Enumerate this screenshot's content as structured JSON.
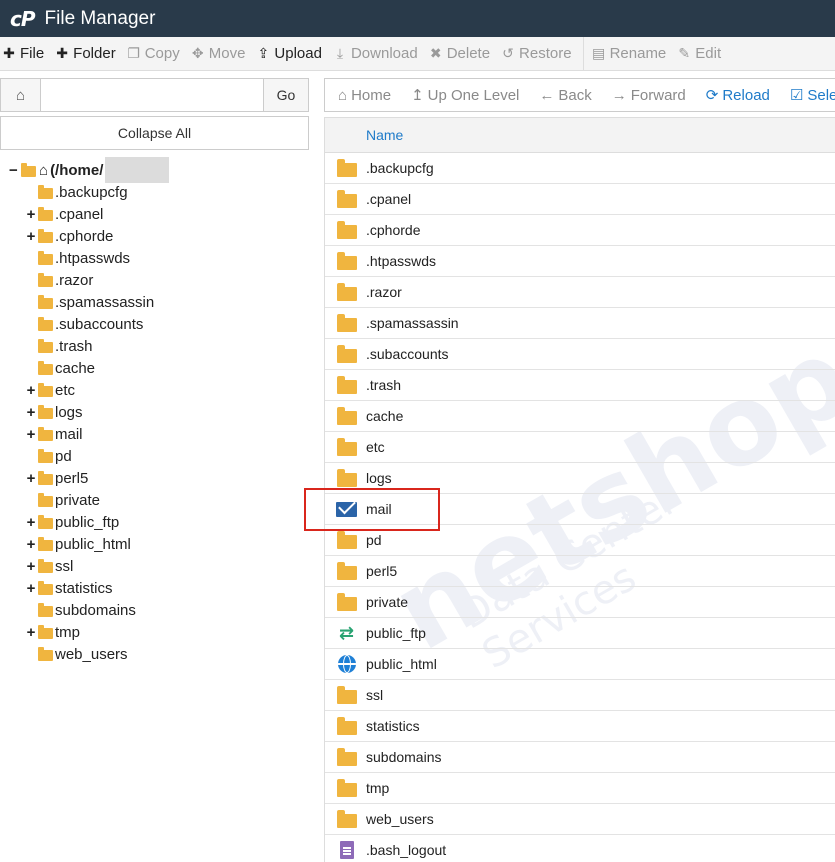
{
  "app": {
    "logo": "cP",
    "title": "File Manager"
  },
  "toolbar": [
    {
      "icon": "plus-icon",
      "glyph": "✚",
      "label": "File",
      "enabled": true
    },
    {
      "icon": "plus-icon",
      "glyph": "✚",
      "label": "Folder",
      "enabled": true
    },
    {
      "icon": "copy-icon",
      "glyph": "❐",
      "label": "Copy",
      "enabled": false
    },
    {
      "icon": "move-icon",
      "glyph": "✥",
      "label": "Move",
      "enabled": false
    },
    {
      "icon": "upload-icon",
      "glyph": "⇪",
      "label": "Upload",
      "enabled": true
    },
    {
      "icon": "download-icon",
      "glyph": "⤓",
      "label": "Download",
      "enabled": false
    },
    {
      "icon": "delete-icon",
      "glyph": "✖",
      "label": "Delete",
      "enabled": false
    },
    {
      "icon": "restore-icon",
      "glyph": "↺",
      "label": "Restore",
      "enabled": false
    },
    {
      "icon": "rename-icon",
      "glyph": "▤",
      "label": "Rename",
      "enabled": false
    },
    {
      "icon": "edit-icon",
      "glyph": "✎",
      "label": "Edit",
      "enabled": false
    }
  ],
  "search": {
    "value": "",
    "go_label": "Go"
  },
  "collapse_label": "Collapse All",
  "tree": {
    "root_label": "(/home/",
    "items": [
      {
        "label": ".backupcfg",
        "expandable": false
      },
      {
        "label": ".cpanel",
        "expandable": true
      },
      {
        "label": ".cphorde",
        "expandable": true
      },
      {
        "label": ".htpasswds",
        "expandable": false
      },
      {
        "label": ".razor",
        "expandable": false
      },
      {
        "label": ".spamassassin",
        "expandable": false
      },
      {
        "label": ".subaccounts",
        "expandable": false
      },
      {
        "label": ".trash",
        "expandable": false
      },
      {
        "label": "cache",
        "expandable": false
      },
      {
        "label": "etc",
        "expandable": true
      },
      {
        "label": "logs",
        "expandable": true
      },
      {
        "label": "mail",
        "expandable": true
      },
      {
        "label": "pd",
        "expandable": false
      },
      {
        "label": "perl5",
        "expandable": true
      },
      {
        "label": "private",
        "expandable": false
      },
      {
        "label": "public_ftp",
        "expandable": true
      },
      {
        "label": "public_html",
        "expandable": true
      },
      {
        "label": "ssl",
        "expandable": true
      },
      {
        "label": "statistics",
        "expandable": true
      },
      {
        "label": "subdomains",
        "expandable": false
      },
      {
        "label": "tmp",
        "expandable": true
      },
      {
        "label": "web_users",
        "expandable": false
      }
    ]
  },
  "nav": [
    {
      "icon": "home-icon",
      "glyph": "⌂",
      "label": "Home",
      "style": "grey"
    },
    {
      "icon": "level-up-icon",
      "glyph": "↥",
      "label": "Up One Level",
      "style": "grey"
    },
    {
      "icon": "back-icon",
      "glyph": "←",
      "label": "Back",
      "style": "grey"
    },
    {
      "icon": "forward-icon",
      "glyph": "→",
      "label": "Forward",
      "style": "grey"
    },
    {
      "icon": "reload-icon",
      "glyph": "⟳",
      "label": "Reload",
      "style": "blue"
    },
    {
      "icon": "select-all-icon",
      "glyph": "☑",
      "label": "Select All",
      "style": "blue"
    }
  ],
  "table": {
    "column_name": "Name",
    "rows": [
      {
        "name": ".backupcfg",
        "type": "folder"
      },
      {
        "name": ".cpanel",
        "type": "folder"
      },
      {
        "name": ".cphorde",
        "type": "folder"
      },
      {
        "name": ".htpasswds",
        "type": "folder"
      },
      {
        "name": ".razor",
        "type": "folder"
      },
      {
        "name": ".spamassassin",
        "type": "folder"
      },
      {
        "name": ".subaccounts",
        "type": "folder"
      },
      {
        "name": ".trash",
        "type": "folder"
      },
      {
        "name": "cache",
        "type": "folder"
      },
      {
        "name": "etc",
        "type": "folder"
      },
      {
        "name": "logs",
        "type": "folder"
      },
      {
        "name": "mail",
        "type": "mail"
      },
      {
        "name": "pd",
        "type": "folder"
      },
      {
        "name": "perl5",
        "type": "folder"
      },
      {
        "name": "private",
        "type": "folder"
      },
      {
        "name": "public_ftp",
        "type": "ftp"
      },
      {
        "name": "public_html",
        "type": "web"
      },
      {
        "name": "ssl",
        "type": "folder"
      },
      {
        "name": "statistics",
        "type": "folder"
      },
      {
        "name": "subdomains",
        "type": "folder"
      },
      {
        "name": "tmp",
        "type": "folder"
      },
      {
        "name": "web_users",
        "type": "folder"
      },
      {
        "name": ".bash_logout",
        "type": "file"
      }
    ]
  },
  "watermark": {
    "text": "netshop",
    "sub": "Data Center Services"
  },
  "colors": {
    "titlebar": "#293a4a",
    "accent": "#1f7bc9",
    "folder": "#f0b53f",
    "highlight": "#d9261c"
  }
}
